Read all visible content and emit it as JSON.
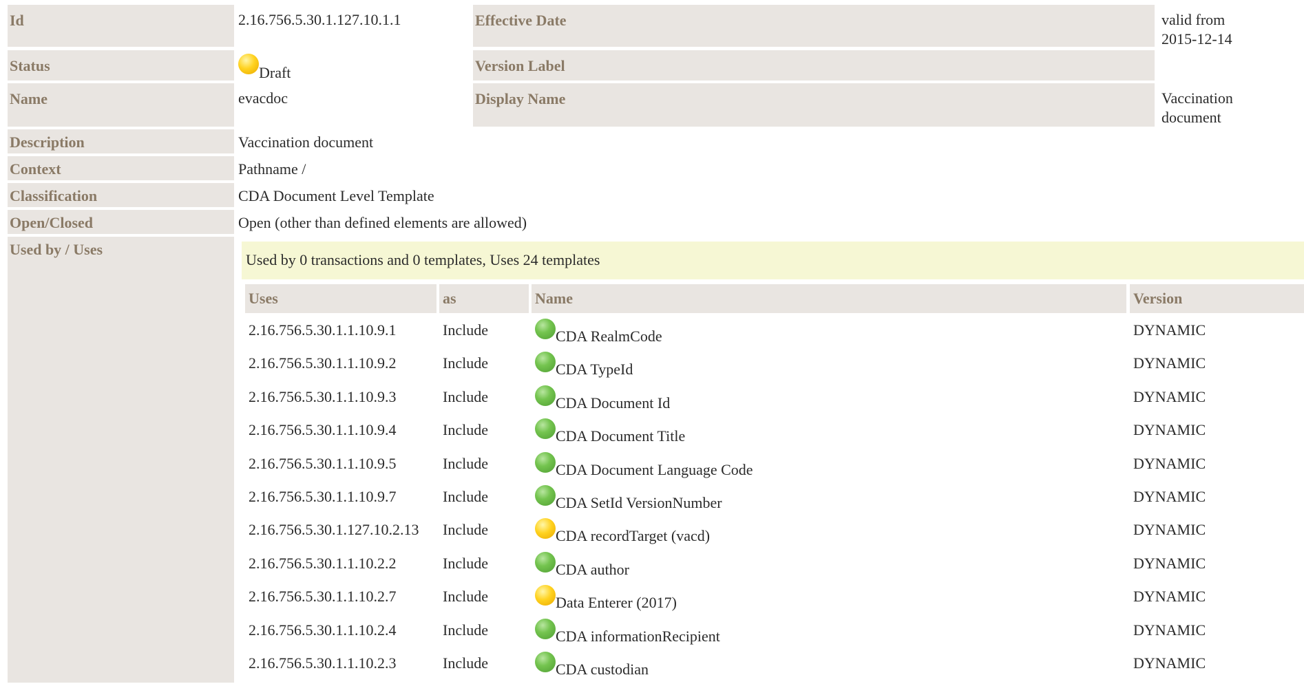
{
  "fields": {
    "id": {
      "label": "Id",
      "value": "2.16.756.5.30.1.127.10.1.1"
    },
    "effective_date": {
      "label": "Effective Date",
      "value_line1": "valid from",
      "value_line2": "2015-12-14"
    },
    "status": {
      "label": "Status",
      "value": "Draft",
      "icon": "status-draft-icon",
      "color": "#ffd21f"
    },
    "version_label": {
      "label": "Version Label",
      "value": ""
    },
    "name": {
      "label": "Name",
      "value": "evacdoc"
    },
    "display_name": {
      "label": "Display Name",
      "value_line1": "Vaccination",
      "value_line2": "document"
    },
    "description": {
      "label": "Description",
      "value": "Vaccination document"
    },
    "context": {
      "label": "Context",
      "value": "Pathname /"
    },
    "classification": {
      "label": "Classification",
      "value": "CDA Document Level Template"
    },
    "open_closed": {
      "label": "Open/Closed",
      "value": "Open (other than defined elements are allowed)"
    },
    "used_by_uses": {
      "label": "Used by / Uses"
    }
  },
  "usage_summary": "Used by 0 transactions and 0 templates, Uses 24 templates",
  "uses_table": {
    "headers": {
      "uses": "Uses",
      "as": "as",
      "name": "Name",
      "version": "Version"
    },
    "rows": [
      {
        "uses": "2.16.756.5.30.1.1.10.9.1",
        "as": "Include",
        "name": "CDA RealmCode",
        "status": "green",
        "version": "DYNAMIC"
      },
      {
        "uses": "2.16.756.5.30.1.1.10.9.2",
        "as": "Include",
        "name": "CDA TypeId",
        "status": "green",
        "version": "DYNAMIC"
      },
      {
        "uses": "2.16.756.5.30.1.1.10.9.3",
        "as": "Include",
        "name": "CDA Document Id",
        "status": "green",
        "version": "DYNAMIC"
      },
      {
        "uses": "2.16.756.5.30.1.1.10.9.4",
        "as": "Include",
        "name": "CDA Document Title",
        "status": "green",
        "version": "DYNAMIC"
      },
      {
        "uses": "2.16.756.5.30.1.1.10.9.5",
        "as": "Include",
        "name": "CDA Document Language Code",
        "status": "green",
        "version": "DYNAMIC"
      },
      {
        "uses": "2.16.756.5.30.1.1.10.9.7",
        "as": "Include",
        "name": "CDA SetId VersionNumber",
        "status": "green",
        "version": "DYNAMIC"
      },
      {
        "uses": "2.16.756.5.30.1.127.10.2.13",
        "as": "Include",
        "name": "CDA recordTarget (vacd)",
        "status": "yellow",
        "version": "DYNAMIC"
      },
      {
        "uses": "2.16.756.5.30.1.1.10.2.2",
        "as": "Include",
        "name": "CDA author",
        "status": "green",
        "version": "DYNAMIC"
      },
      {
        "uses": "2.16.756.5.30.1.1.10.2.7",
        "as": "Include",
        "name": "Data Enterer (2017)",
        "status": "yellow",
        "version": "DYNAMIC"
      },
      {
        "uses": "2.16.756.5.30.1.1.10.2.4",
        "as": "Include",
        "name": "CDA informationRecipient",
        "status": "green",
        "version": "DYNAMIC"
      },
      {
        "uses": "2.16.756.5.30.1.1.10.2.3",
        "as": "Include",
        "name": "CDA custodian",
        "status": "green",
        "version": "DYNAMIC"
      }
    ]
  },
  "colors": {
    "label_bg": "#e9e5e1",
    "label_text": "#8a7a66",
    "summary_bg": "#f6f7d4",
    "active": "#74c44f",
    "draft": "#ffd21f"
  }
}
